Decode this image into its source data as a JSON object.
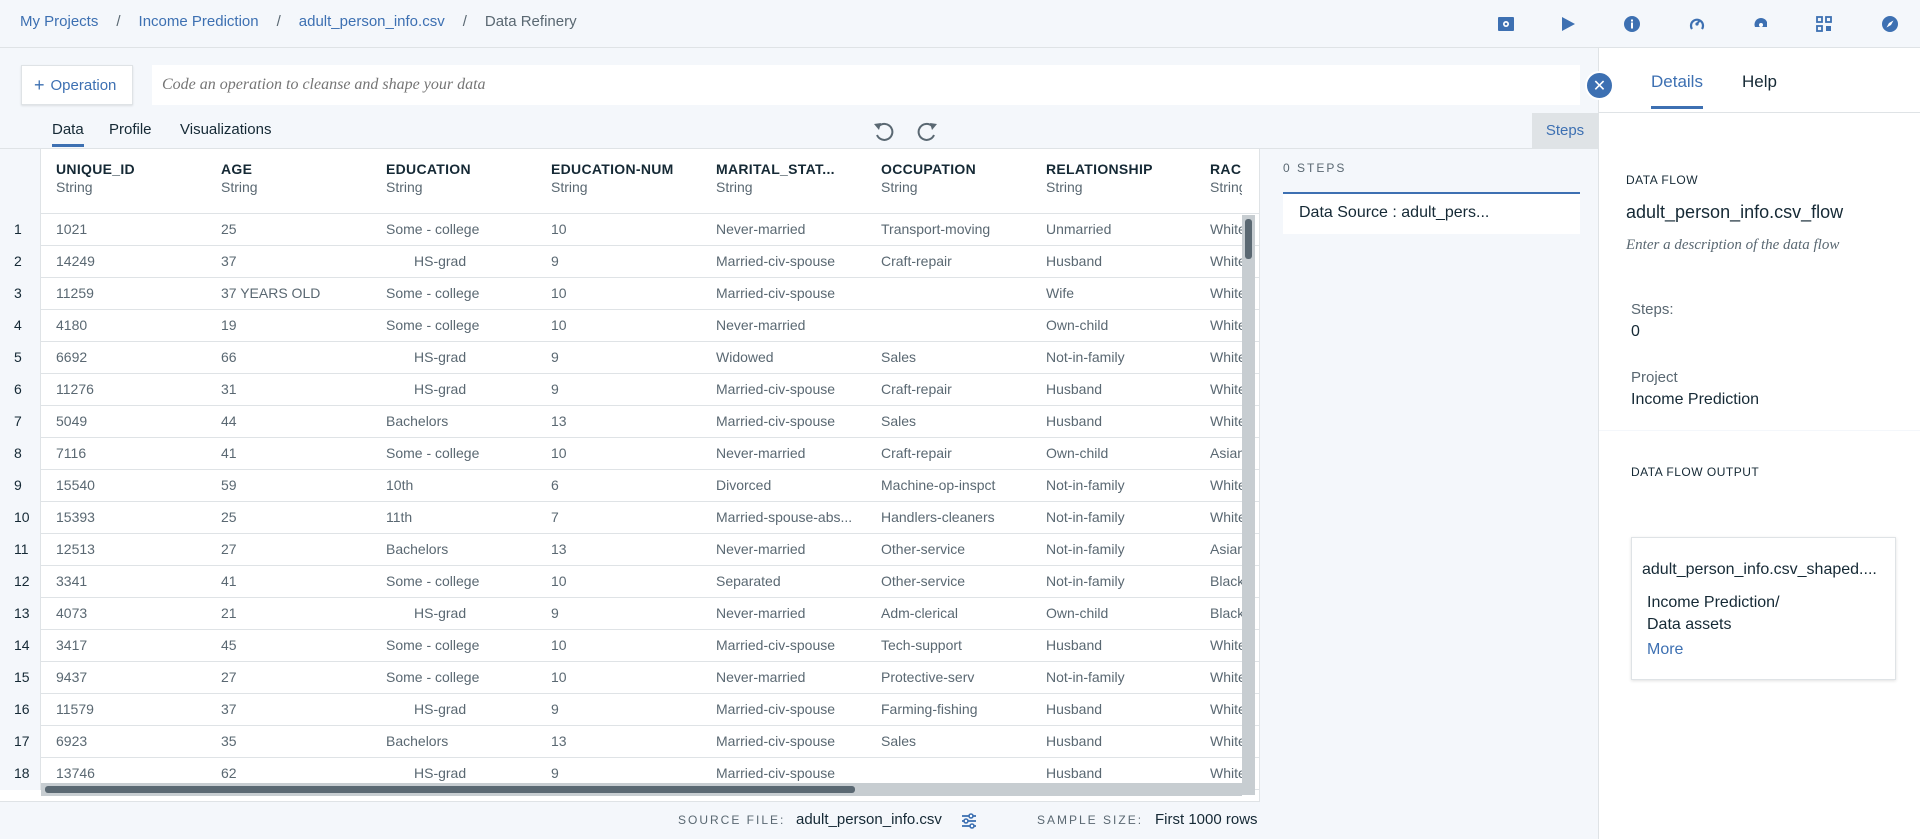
{
  "breadcrumb": {
    "items": [
      "My Projects",
      "Income Prediction",
      "adult_person_info.csv"
    ],
    "current": "Data Refinery",
    "separator": "/"
  },
  "top_icons": [
    "save-job-icon",
    "run-icon",
    "info-icon",
    "settings-icon",
    "environment-icon",
    "grid-icon",
    "compass-icon"
  ],
  "toolbar": {
    "operation_label": "Operation",
    "code_placeholder": "Code an operation to cleanse and shape your data"
  },
  "tabs": [
    "Data",
    "Profile",
    "Visualizations"
  ],
  "steps_button": "Steps",
  "columns": [
    {
      "name": "UNIQUE_ID",
      "type": "String"
    },
    {
      "name": "AGE",
      "type": "String"
    },
    {
      "name": "EDUCATION",
      "type": "String"
    },
    {
      "name": "EDUCATION-NUM",
      "type": "String"
    },
    {
      "name": "MARITAL_STAT...",
      "type": "String"
    },
    {
      "name": "OCCUPATION",
      "type": "String"
    },
    {
      "name": "RELATIONSHIP",
      "type": "String"
    },
    {
      "name": "RACE",
      "type": "String"
    }
  ],
  "rows": [
    [
      "1021",
      "25",
      "Some - college",
      "10",
      "Never-married",
      "Transport-moving",
      "Unmarried",
      "White"
    ],
    [
      "14249",
      "37",
      "HS-grad",
      "9",
      "Married-civ-spouse",
      "Craft-repair",
      "Husband",
      "White"
    ],
    [
      "11259",
      "37 YEARS OLD",
      "Some - college",
      "10",
      "Married-civ-spouse",
      "",
      "Wife",
      "White"
    ],
    [
      "4180",
      "19",
      "Some - college",
      "10",
      "Never-married",
      "",
      "Own-child",
      "White"
    ],
    [
      "6692",
      "66",
      "HS-grad",
      "9",
      "Widowed",
      "Sales",
      "Not-in-family",
      "White"
    ],
    [
      "11276",
      "31",
      "HS-grad",
      "9",
      "Married-civ-spouse",
      "Craft-repair",
      "Husband",
      "White"
    ],
    [
      "5049",
      "44",
      "Bachelors",
      "13",
      "Married-civ-spouse",
      "Sales",
      "Husband",
      "White"
    ],
    [
      "7116",
      "41",
      "Some - college",
      "10",
      "Never-married",
      "Craft-repair",
      "Own-child",
      "Asian"
    ],
    [
      "15540",
      "59",
      "10th",
      "6",
      "Divorced",
      "Machine-op-inspct",
      "Not-in-family",
      "White"
    ],
    [
      "15393",
      "25",
      "11th",
      "7",
      "Married-spouse-abs...",
      "Handlers-cleaners",
      "Not-in-family",
      "White"
    ],
    [
      "12513",
      "27",
      "Bachelors",
      "13",
      "Never-married",
      "Other-service",
      "Not-in-family",
      "Asian"
    ],
    [
      "3341",
      "41",
      "Some - college",
      "10",
      "Separated",
      "Other-service",
      "Not-in-family",
      "Black"
    ],
    [
      "4073",
      "21",
      "HS-grad",
      "9",
      "Never-married",
      "Adm-clerical",
      "Own-child",
      "Black"
    ],
    [
      "3417",
      "45",
      "Some - college",
      "10",
      "Married-civ-spouse",
      "Tech-support",
      "Husband",
      "White"
    ],
    [
      "9437",
      "27",
      "Some - college",
      "10",
      "Never-married",
      "Protective-serv",
      "Not-in-family",
      "White"
    ],
    [
      "11579",
      "37",
      "HS-grad",
      "9",
      "Married-civ-spouse",
      "Farming-fishing",
      "Husband",
      "White"
    ],
    [
      "6923",
      "35",
      "Bachelors",
      "13",
      "Married-civ-spouse",
      "Sales",
      "Husband",
      "White"
    ],
    [
      "13746",
      "62",
      "HS-grad",
      "9",
      "Married-civ-spouse",
      "",
      "Husband",
      "White"
    ]
  ],
  "footer": {
    "source_label": "SOURCE FILE:",
    "source_value": "adult_person_info.csv",
    "sample_label": "SAMPLE SIZE:",
    "sample_value": "First 1000 rows"
  },
  "steps_panel": {
    "title": "0 STEPS",
    "step": "Data Source : adult_pers..."
  },
  "details": {
    "tabs": [
      "Details",
      "Help"
    ],
    "data_flow_label": "DATA FLOW",
    "flow_name": "adult_person_info.csv_flow",
    "description_placeholder": "Enter a description of the data flow",
    "steps_label": "Steps:",
    "steps_value": "0",
    "project_label": "Project",
    "project_value": "Income Prediction",
    "output_label": "DATA FLOW OUTPUT",
    "output_name": "adult_person_info.csv_shaped....",
    "output_path": "Income Prediction/",
    "output_location": "Data assets",
    "more_link": "More"
  },
  "colors": {
    "accent": "#3d70b2",
    "text": "#152935",
    "muted": "#5a6872",
    "background": "#f4f7fb",
    "border": "#dfe3e6"
  }
}
